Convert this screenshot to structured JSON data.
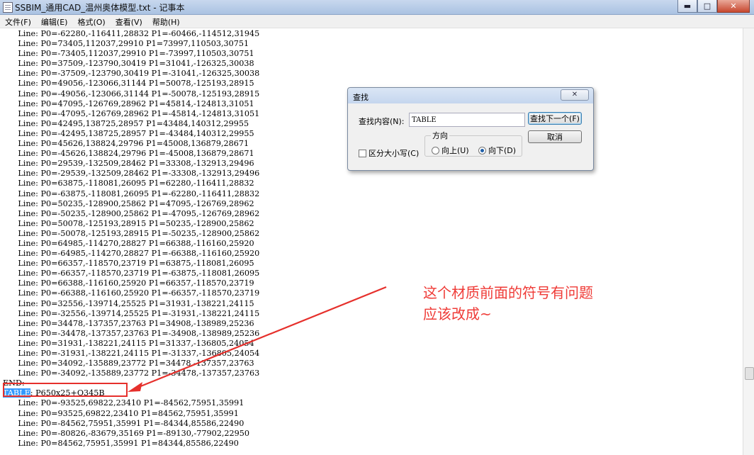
{
  "window": {
    "title": "SSBIM_通用CAD_温州奥体模型.txt - 记事本",
    "minimize": "▬",
    "maximize": "□",
    "close": "✕"
  },
  "menu": [
    "文件(F)",
    "编辑(E)",
    "格式(O)",
    "查看(V)",
    "帮助(H)"
  ],
  "content": {
    "lines_before": [
      "      Line: P0=-62280,-116411,28832 P1=-60466,-114512,31945",
      "      Line: P0=73405,112037,29910 P1=73997,110503,30751",
      "      Line: P0=-73405,112037,29910 P1=-73997,110503,30751",
      "      Line: P0=37509,-123790,30419 P1=31041,-126325,30038",
      "      Line: P0=-37509,-123790,30419 P1=-31041,-126325,30038",
      "      Line: P0=49056,-123066,31144 P1=50078,-125193,28915",
      "      Line: P0=-49056,-123066,31144 P1=-50078,-125193,28915",
      "      Line: P0=47095,-126769,28962 P1=45814,-124813,31051",
      "      Line: P0=-47095,-126769,28962 P1=-45814,-124813,31051",
      "      Line: P0=42495,138725,28957 P1=43484,140312,29955",
      "      Line: P0=-42495,138725,28957 P1=-43484,140312,29955",
      "      Line: P0=45626,138824,29796 P1=45008,136879,28671",
      "      Line: P0=-45626,138824,29796 P1=-45008,136879,28671",
      "      Line: P0=29539,-132509,28462 P1=33308,-132913,29496",
      "      Line: P0=-29539,-132509,28462 P1=-33308,-132913,29496",
      "      Line: P0=63875,-118081,26095 P1=62280,-116411,28832",
      "      Line: P0=-63875,-118081,26095 P1=-62280,-116411,28832",
      "      Line: P0=50235,-128900,25862 P1=47095,-126769,28962",
      "      Line: P0=-50235,-128900,25862 P1=-47095,-126769,28962",
      "      Line: P0=50078,-125193,28915 P1=50235,-128900,25862",
      "      Line: P0=-50078,-125193,28915 P1=-50235,-128900,25862",
      "      Line: P0=64985,-114270,28827 P1=66388,-116160,25920",
      "      Line: P0=-64985,-114270,28827 P1=-66388,-116160,25920",
      "      Line: P0=66357,-118570,23719 P1=63875,-118081,26095",
      "      Line: P0=-66357,-118570,23719 P1=-63875,-118081,26095",
      "      Line: P0=66388,-116160,25920 P1=66357,-118570,23719",
      "      Line: P0=-66388,-116160,25920 P1=-66357,-118570,23719",
      "      Line: P0=32556,-139714,25525 P1=31931,-138221,24115",
      "      Line: P0=-32556,-139714,25525 P1=-31931,-138221,24115",
      "      Line: P0=34478,-137357,23763 P1=34908,-138989,25236",
      "      Line: P0=-34478,-137357,23763 P1=-34908,-138989,25236",
      "      Line: P0=31931,-138221,24115 P1=31337,-136805,24054",
      "      Line: P0=-31931,-138221,24115 P1=-31337,-136805,24054",
      "      Line: P0=34092,-135889,23772 P1=34478,-137357,23763",
      "      Line: P0=-34092,-135889,23772 P1=-34478,-137357,23763",
      "END:"
    ],
    "table_keyword": "TABLE",
    "table_rest": ": P650x25+Q345B",
    "lines_after": [
      "      Line: P0=-93525,69822,23410 P1=-84562,75951,35991",
      "      Line: P0=93525,69822,23410 P1=84562,75951,35991",
      "      Line: P0=-84562,75951,35991 P1=-84344,85586,22490",
      "      Line: P0=-80826,-83679,35169 P1=-89130,-77902,22950",
      "      Line: P0=84562,75951,35991 P1=84344,85586,22490"
    ]
  },
  "find_dialog": {
    "title": "查找",
    "close": "✕",
    "find_label": "查找内容(N):",
    "find_value": "TABLE",
    "find_next": "查找下一个(F)",
    "cancel": "取消",
    "direction_label": "方向",
    "up": "向上(U)",
    "down": "向下(D)",
    "match_case": "区分大小写(C)"
  },
  "annotation": {
    "line1": "这个材质前面的符号有问题",
    "line2": "应该改成~",
    "color": "#ef3b37"
  }
}
